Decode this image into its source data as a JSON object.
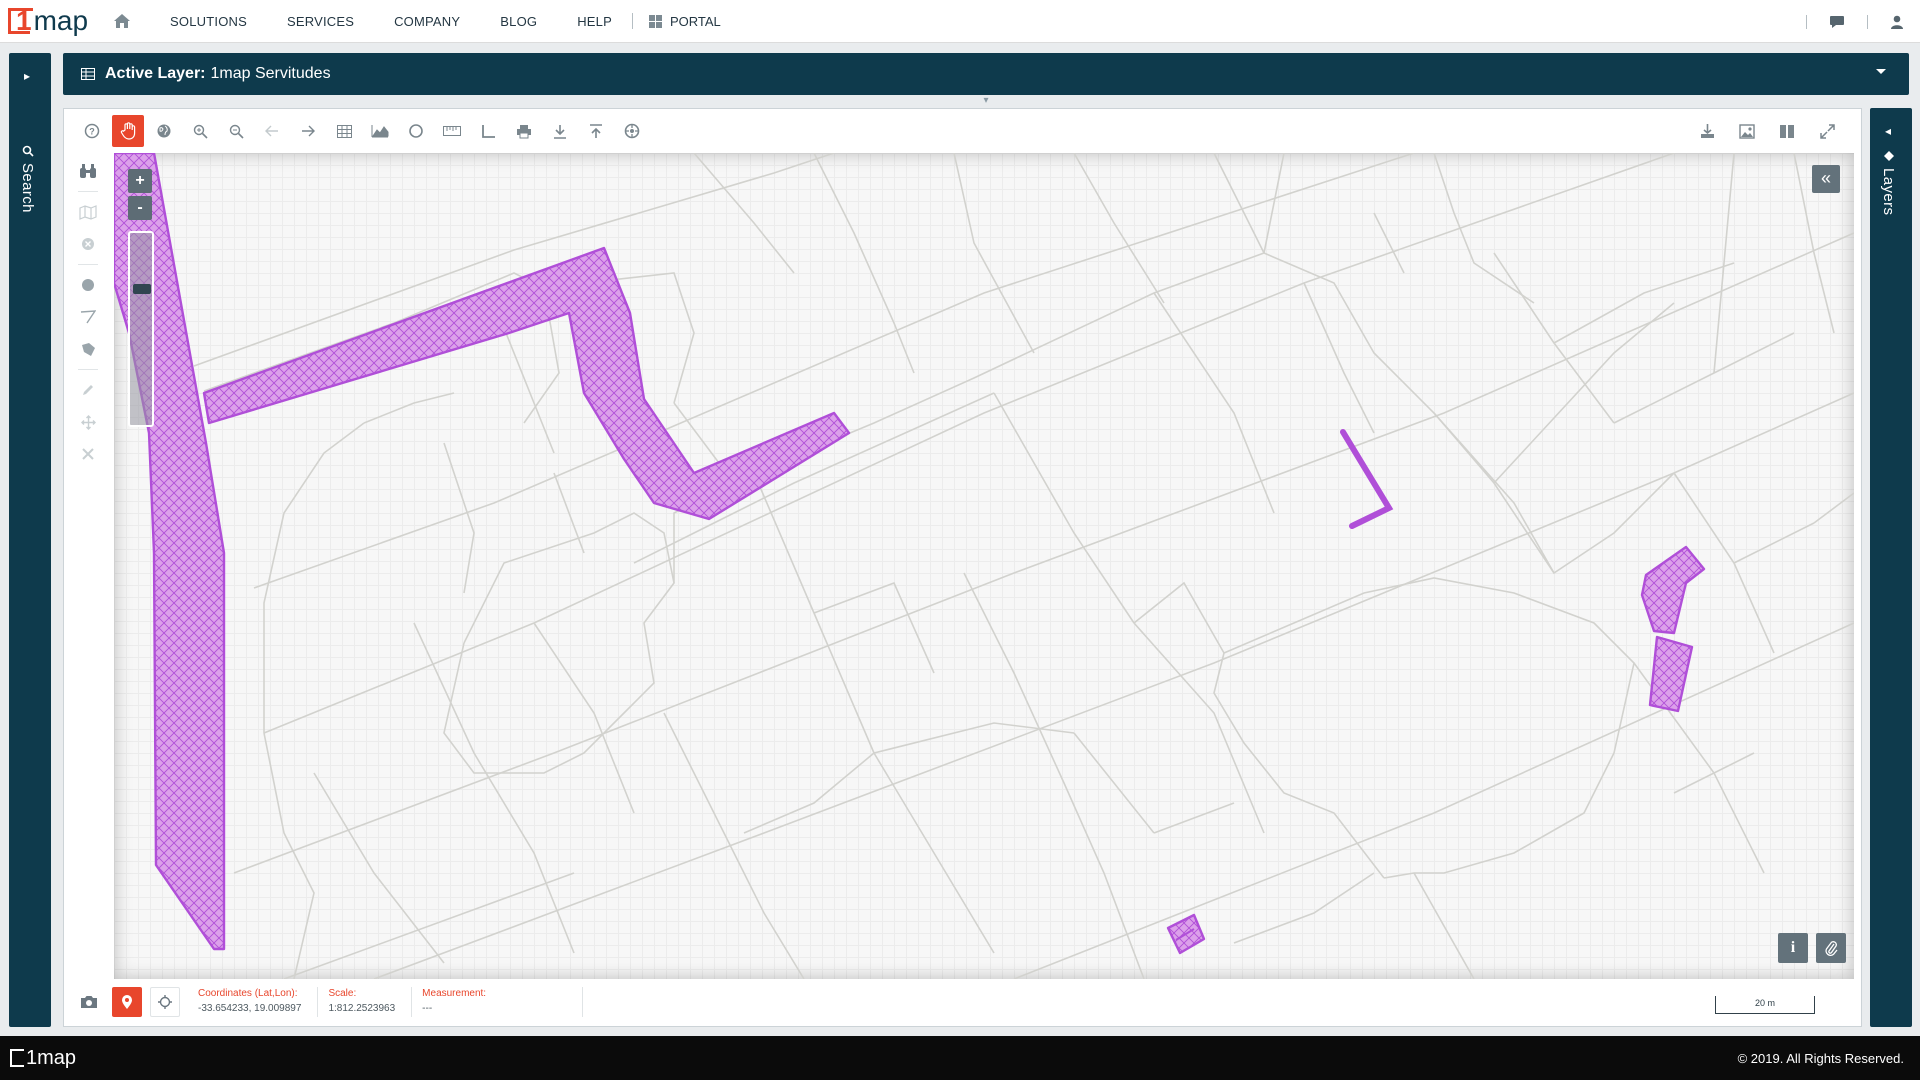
{
  "nav": {
    "logo_num": "1",
    "logo_text": "map",
    "items": [
      "SOLUTIONS",
      "SERVICES",
      "COMPANY",
      "BLOG",
      "HELP"
    ],
    "portal_label": "PORTAL"
  },
  "left_panel": {
    "label": "Search"
  },
  "right_panel": {
    "label": "Layers"
  },
  "layer_bar": {
    "label": "Active Layer:",
    "value": "1map Servitudes"
  },
  "toolbar": {
    "tools": [
      "help-icon",
      "pan-hand-icon",
      "globe-icon",
      "zoom-in-icon",
      "zoom-out-icon",
      "back-arrow-icon",
      "forward-arrow-icon",
      "table-icon",
      "chart-icon",
      "circle-icon",
      "ruler-icon",
      "angle-icon",
      "print-icon",
      "download-icon",
      "upload-icon",
      "settings-wheel-icon"
    ],
    "right_tools": [
      "export-icon",
      "image-icon",
      "split-view-icon",
      "fullscreen-icon"
    ]
  },
  "vertical_tools": [
    "binoculars-icon",
    "map-icon",
    "clear-icon",
    "circle-draw-icon",
    "polyline-draw-icon",
    "polygon-draw-icon",
    "edit-pencil-icon",
    "move-icon",
    "delete-icon"
  ],
  "map": {
    "zoom_in": "+",
    "zoom_out": "-",
    "collapse": "«",
    "info_label": "i",
    "zoom_level": 0.28
  },
  "status": {
    "coords_label": "Coordinates (Lat,Lon):",
    "coords_value": "-33.654233, 19.009897",
    "scale_label": "Scale:",
    "scale_value": "1:812.2523963",
    "measure_label": "Measurement:",
    "measure_value": "---",
    "scalebar_text": "20 m"
  },
  "footer": {
    "logo_text": "1map",
    "copyright": "© 2019. All Rights Reserved."
  },
  "colors": {
    "brand": "#e8462c",
    "panel": "#0e3a4c",
    "servitude": "#b04fd8"
  }
}
